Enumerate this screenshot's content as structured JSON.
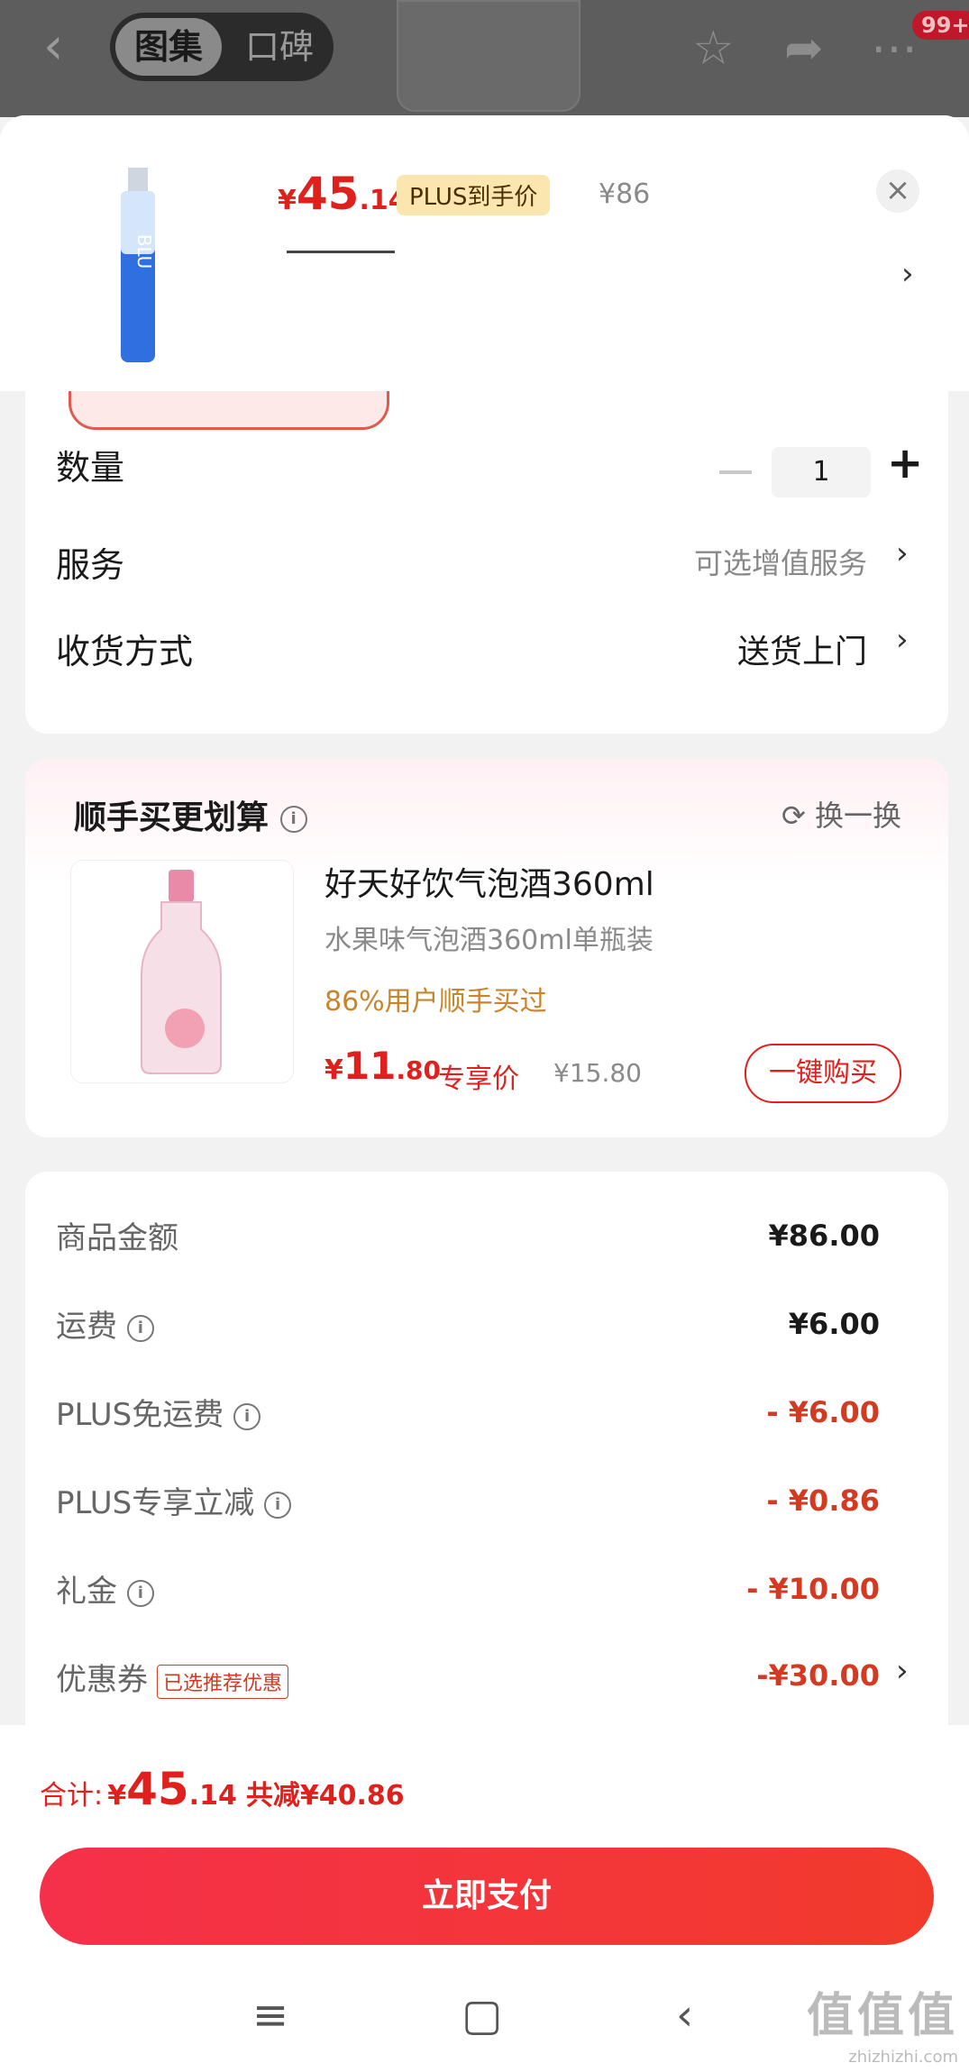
{
  "header": {
    "tabs": [
      {
        "label": "图集"
      },
      {
        "label": "口碑"
      }
    ],
    "badge": "99+"
  },
  "product": {
    "price_currency": "¥",
    "price_int": "45",
    "price_dec": ".14",
    "plus_label": "PLUS到手价",
    "original_price": "¥86",
    "close_symbol": "×"
  },
  "options": {
    "quantity_label": "数量",
    "quantity_value": "1",
    "service_label": "服务",
    "service_value": "可选增值服务",
    "delivery_label": "收货方式",
    "delivery_value": "送货上门"
  },
  "recommend": {
    "title": "顺手买更划算",
    "swap_label": "换一换",
    "name": "好天好饮气泡酒360ml",
    "desc": "水果味气泡酒360ml单瓶装",
    "hint": "86%用户顺手买过",
    "price_currency": "¥",
    "price_int": "11",
    "price_dec": ".80",
    "price_tag": "专享价",
    "original_price": "¥15.80",
    "buy_label": "一键购买"
  },
  "summary": {
    "rows": [
      {
        "label": "商品金额",
        "value": "¥86.00"
      },
      {
        "label": "运费",
        "value": "¥6.00"
      },
      {
        "label": "PLUS免运费",
        "value": "- ¥6.00"
      },
      {
        "label": "PLUS专享立减",
        "value": "- ¥0.86"
      },
      {
        "label": "礼金",
        "value": "- ¥10.00"
      },
      {
        "label": "优惠券",
        "value": "-¥30.00"
      }
    ],
    "coupon_tag": "已选推荐优惠"
  },
  "footer": {
    "total_label": "合计:",
    "total_currency": "¥",
    "total_int": "45",
    "total_dec": ".14",
    "saved": "共减¥40.86",
    "pay_label": "立即支付"
  },
  "watermark": {
    "text": "值值值",
    "url": "zhizhizhi.com"
  },
  "colors": {
    "accent": "#e0201c",
    "plus_tag_bg": "#fbe6b0",
    "hint": "#c8852c"
  }
}
